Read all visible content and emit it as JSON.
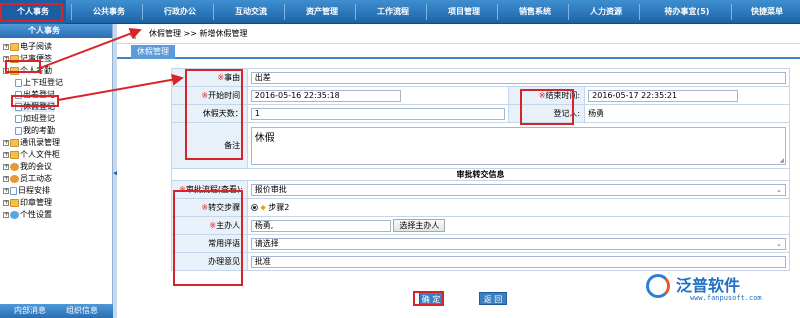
{
  "topnav": {
    "items": [
      "个人事务",
      "公共事务",
      "行政办公",
      "互动交流",
      "资产管理",
      "工作流程",
      "项目管理",
      "销售系统",
      "人力资源",
      "待办事宜(5)",
      "快捷菜单"
    ]
  },
  "sidebar": {
    "title": "个人事务",
    "tree": [
      {
        "label": "电子阅读"
      },
      {
        "label": "记事便签"
      },
      {
        "label": "个人考勤"
      },
      {
        "label": "上下班登记"
      },
      {
        "label": "出差登记"
      },
      {
        "label": "休假登记"
      },
      {
        "label": "加班登记"
      },
      {
        "label": "我的考勤"
      },
      {
        "label": "通讯录管理"
      },
      {
        "label": "个人文件柜"
      },
      {
        "label": "我的会议"
      },
      {
        "label": "员工动态"
      },
      {
        "label": "日程安排"
      },
      {
        "label": "印章管理"
      },
      {
        "label": "个性设置"
      }
    ],
    "footer": {
      "left": "内部消息",
      "right": "组织信息"
    }
  },
  "breadcrumb": {
    "root": "休假管理",
    "sep": ">>",
    "current": "新增休假管理"
  },
  "tab": {
    "label": "休假管理"
  },
  "form": {
    "required_mark": "※",
    "reason_label": "事由:",
    "reason_value": "出差",
    "start_label": "开始时间:",
    "start_value": "2016-05-16 22:35:18",
    "end_label": "结束时间:",
    "end_value": "2016-05-17 22:35:21",
    "days_label": "休假天数：",
    "days_value": "1",
    "registrar_label": "登记人:",
    "registrar_value": "杨勇",
    "remark_label": "备注:",
    "remark_value": "休假"
  },
  "approval": {
    "section_title": "审批转交信息",
    "flow_label": "审批流程(查看):",
    "flow_value": "报价审批",
    "step_label": "转交步骤:",
    "step_value": "步骤2",
    "handler_label": "主办人:",
    "handler_value": "杨勇,",
    "handler_button": "选择主办人",
    "phrase_label": "常用评语:",
    "phrase_value": "请选择",
    "opinion_label": "办理意见:",
    "opinion_value": "批准"
  },
  "actions": {
    "confirm": "确 定",
    "back": "返 回"
  },
  "logo": {
    "name": "泛普软件",
    "url": "www.fanpusoft.com"
  },
  "colors": {
    "accent": "#1d63a8",
    "annotation": "#d7232a",
    "required": "#e0262b"
  }
}
